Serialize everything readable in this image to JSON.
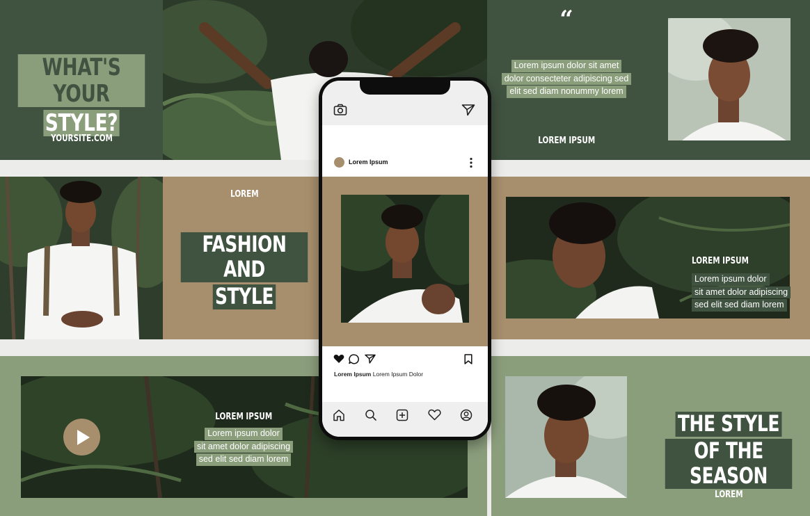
{
  "tile1": {
    "title_line1": "WHAT'S YOUR",
    "title_line2": "STYLE?",
    "site": "YOURSITE.COM"
  },
  "tile3": {
    "quote_mark": "“",
    "body": [
      "Lorem ipsum dolor sit amet",
      "dolor consecteter adipiscing sed",
      "elit sed diam nonummy lorem"
    ],
    "label": "LOREM IPSUM"
  },
  "tile5": {
    "label": "LOREM",
    "title_line1": "FASHION AND",
    "title_line2": "STYLE"
  },
  "tile6": {
    "label": "LOREM IPSUM",
    "body": [
      "Lorem ipsum dolor",
      "sit amet dolor adipiscing",
      "sed elit sed diam lorem"
    ]
  },
  "tile7": {
    "label": "LOREM IPSUM",
    "body": [
      "Lorem ipsum dolor",
      "sit amet dolor adipiscing",
      "sed elit sed diam lorem"
    ]
  },
  "tile8": {
    "title_line1": "THE STYLE",
    "title_line2": "OF THE SEASON",
    "label": "LOREM"
  },
  "phone": {
    "username": "Lorem Ipsum",
    "caption_user": "Lorem Ipsum",
    "caption_text": "Lorem Ipsum Dolor",
    "icons": [
      "camera-icon",
      "send-icon",
      "more-icon",
      "heart-icon",
      "comment-icon",
      "share-icon",
      "bookmark-icon",
      "home-icon",
      "search-icon",
      "add-icon",
      "activity-icon",
      "profile-icon"
    ]
  },
  "colors": {
    "dark_green": "#405240",
    "tan": "#a78f6d",
    "sage": "#8b9e7c",
    "light_bg": "#ececea"
  }
}
